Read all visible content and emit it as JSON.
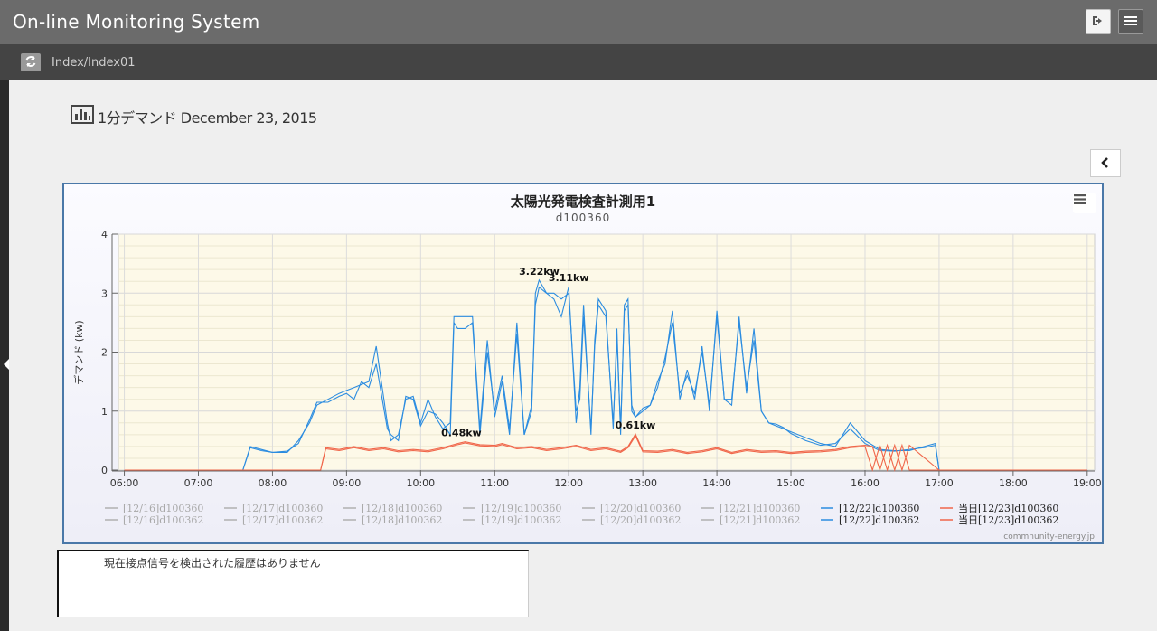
{
  "header": {
    "app_title": "On-line Monitoring System"
  },
  "icons": {
    "logout": "sign-out-icon",
    "menu": "hamburger-icon",
    "refresh": "refresh-icon",
    "chart": "bar-chart-icon",
    "collapse": "chevron-left-icon"
  },
  "breadcrumb": {
    "text": "Index/Index01"
  },
  "page": {
    "heading": "1分デマンド December 23, 2015"
  },
  "messages": {
    "no_history": "現在接点信号を検出された履歴はありません"
  },
  "chart_data": {
    "type": "line",
    "title": "太陽光発電検査計測用1",
    "subtitle": "d100360",
    "ylabel": "デマンド (kw)",
    "xlabel": "",
    "ylim": [
      0,
      4
    ],
    "x_ticks": [
      "06:00",
      "07:00",
      "08:00",
      "09:00",
      "10:00",
      "11:00",
      "12:00",
      "13:00",
      "14:00",
      "15:00",
      "16:00",
      "17:00",
      "18:00",
      "19:00"
    ],
    "y_ticks": [
      "0",
      "1",
      "2",
      "3",
      "4"
    ],
    "xlim_hours": [
      5.92,
      19.1
    ],
    "grid": true,
    "credit": "commnunity-energy.jp",
    "colors": {
      "blue": "#2b8ce0",
      "red": "#f0664a",
      "gray": "#b0b0b0",
      "plot_bg": "#fdf9e8"
    },
    "annotations": [
      {
        "text": "3.22kw",
        "x": 11.6,
        "y": 3.22
      },
      {
        "text": "3.11kw",
        "x": 12.0,
        "y": 3.11
      },
      {
        "text": "0.48kw",
        "x": 10.55,
        "y": 0.48
      },
      {
        "text": "0.61kw",
        "x": 12.9,
        "y": 0.61
      }
    ],
    "legend": [
      [
        {
          "name": "[12/16]d100360",
          "color": "#b0b0b0",
          "visible": false
        },
        {
          "name": "[12/17]d100360",
          "color": "#b0b0b0",
          "visible": false
        },
        {
          "name": "[12/18]d100360",
          "color": "#b0b0b0",
          "visible": false
        },
        {
          "name": "[12/19]d100360",
          "color": "#b0b0b0",
          "visible": false
        },
        {
          "name": "[12/20]d100360",
          "color": "#b0b0b0",
          "visible": false
        },
        {
          "name": "[12/21]d100360",
          "color": "#b0b0b0",
          "visible": false
        },
        {
          "name": "[12/22]d100360",
          "color": "#2b8ce0",
          "visible": true
        },
        {
          "name": "当日[12/23]d100360",
          "color": "#f0664a",
          "visible": true
        }
      ],
      [
        {
          "name": "[12/16]d100362",
          "color": "#b0b0b0",
          "visible": false
        },
        {
          "name": "[12/17]d100362",
          "color": "#b0b0b0",
          "visible": false
        },
        {
          "name": "[12/18]d100362",
          "color": "#b0b0b0",
          "visible": false
        },
        {
          "name": "[12/19]d100362",
          "color": "#b0b0b0",
          "visible": false
        },
        {
          "name": "[12/20]d100362",
          "color": "#b0b0b0",
          "visible": false
        },
        {
          "name": "[12/21]d100362",
          "color": "#b0b0b0",
          "visible": false
        },
        {
          "name": "[12/22]d100362",
          "color": "#2b8ce0",
          "visible": true
        },
        {
          "name": "当日[12/23]d100362",
          "color": "#f0664a",
          "visible": true
        }
      ]
    ],
    "series": [
      {
        "name": "[12/22]d100360",
        "color": "#2b8ce0",
        "x": [
          6.0,
          7.6,
          7.7,
          7.85,
          8.0,
          8.2,
          8.35,
          8.5,
          8.6,
          8.75,
          8.9,
          9.0,
          9.1,
          9.2,
          9.3,
          9.4,
          9.55,
          9.6,
          9.7,
          9.8,
          9.9,
          10.0,
          10.1,
          10.2,
          10.3,
          10.4,
          10.45,
          10.5,
          10.6,
          10.7,
          10.8,
          10.9,
          11.0,
          11.1,
          11.2,
          11.3,
          11.4,
          11.5,
          11.55,
          11.6,
          11.7,
          11.8,
          11.9,
          12.0,
          12.1,
          12.15,
          12.2,
          12.3,
          12.35,
          12.4,
          12.5,
          12.6,
          12.65,
          12.7,
          12.75,
          12.8,
          12.85,
          12.9,
          13.0,
          13.1,
          13.2,
          13.3,
          13.4,
          13.5,
          13.6,
          13.7,
          13.8,
          13.9,
          14.0,
          14.1,
          14.2,
          14.3,
          14.4,
          14.5,
          14.6,
          14.7,
          14.8,
          14.9,
          15.0,
          15.2,
          15.4,
          15.6,
          15.8,
          16.0,
          16.2,
          16.4,
          16.6,
          16.8,
          16.95,
          17.0,
          18.0,
          19.0
        ],
        "y": [
          0,
          0,
          0.4,
          0.35,
          0.3,
          0.3,
          0.5,
          0.8,
          1.1,
          1.2,
          1.3,
          1.35,
          1.4,
          1.45,
          1.5,
          2.1,
          0.8,
          0.5,
          0.6,
          1.2,
          1.25,
          0.8,
          1.2,
          0.9,
          0.7,
          0.8,
          2.6,
          2.6,
          2.6,
          2.6,
          0.7,
          2.2,
          0.9,
          1.5,
          0.6,
          2.5,
          0.6,
          1.0,
          3.0,
          3.22,
          3.0,
          2.9,
          2.6,
          3.11,
          0.8,
          1.4,
          2.8,
          0.6,
          2.2,
          2.9,
          2.7,
          0.7,
          2.4,
          0.6,
          2.8,
          2.9,
          1.0,
          0.9,
          1.0,
          1.1,
          1.5,
          1.8,
          2.7,
          1.2,
          1.7,
          1.2,
          2.1,
          1.0,
          2.7,
          1.2,
          1.1,
          2.6,
          1.3,
          2.4,
          1.0,
          0.8,
          0.75,
          0.7,
          0.65,
          0.55,
          0.45,
          0.4,
          0.8,
          0.5,
          0.35,
          0.33,
          0.33,
          0.4,
          0.45,
          0,
          0,
          0
        ]
      },
      {
        "name": "[12/22]d100362",
        "color": "#2b8ce0",
        "x": [
          6.0,
          7.6,
          7.7,
          7.85,
          8.0,
          8.2,
          8.35,
          8.5,
          8.6,
          8.75,
          8.9,
          9.0,
          9.1,
          9.2,
          9.3,
          9.4,
          9.55,
          9.6,
          9.7,
          9.8,
          9.9,
          10.0,
          10.1,
          10.2,
          10.3,
          10.4,
          10.45,
          10.5,
          10.6,
          10.7,
          10.8,
          10.9,
          11.0,
          11.1,
          11.2,
          11.3,
          11.4,
          11.5,
          11.55,
          11.6,
          11.7,
          11.8,
          11.9,
          12.0,
          12.1,
          12.15,
          12.2,
          12.3,
          12.35,
          12.4,
          12.5,
          12.6,
          12.65,
          12.7,
          12.75,
          12.8,
          12.85,
          12.9,
          13.0,
          13.1,
          13.2,
          13.3,
          13.4,
          13.5,
          13.6,
          13.7,
          13.8,
          13.9,
          14.0,
          14.1,
          14.2,
          14.3,
          14.4,
          14.5,
          14.6,
          14.7,
          14.8,
          14.9,
          15.0,
          15.2,
          15.4,
          15.6,
          15.8,
          16.0,
          16.2,
          16.4,
          16.6,
          16.8,
          16.95,
          17.0,
          18.0,
          19.0
        ],
        "y": [
          0,
          0,
          0.38,
          0.33,
          0.3,
          0.32,
          0.45,
          0.85,
          1.15,
          1.15,
          1.25,
          1.3,
          1.2,
          1.5,
          1.4,
          1.8,
          0.7,
          0.6,
          0.5,
          1.25,
          1.2,
          0.75,
          1.0,
          0.95,
          0.8,
          0.6,
          2.5,
          2.4,
          2.4,
          2.5,
          0.6,
          2.0,
          1.0,
          1.6,
          0.7,
          2.3,
          0.6,
          1.1,
          2.8,
          3.1,
          3.0,
          3.0,
          2.9,
          3.0,
          1.0,
          1.2,
          2.6,
          0.7,
          2.1,
          2.8,
          2.6,
          0.8,
          2.2,
          0.7,
          2.7,
          2.8,
          1.1,
          0.9,
          1.05,
          1.1,
          1.4,
          1.9,
          2.5,
          1.3,
          1.6,
          1.3,
          2.0,
          1.1,
          2.6,
          1.2,
          1.2,
          2.5,
          1.4,
          2.2,
          1.0,
          0.8,
          0.78,
          0.72,
          0.62,
          0.5,
          0.42,
          0.45,
          0.7,
          0.45,
          0.33,
          0.32,
          0.35,
          0.38,
          0.42,
          0,
          0,
          0
        ]
      },
      {
        "name": "当日[12/23]d100360",
        "color": "#f0664a",
        "x": [
          6.0,
          8.65,
          8.72,
          8.9,
          9.1,
          9.3,
          9.5,
          9.7,
          9.9,
          10.1,
          10.3,
          10.5,
          10.6,
          10.8,
          11.0,
          11.1,
          11.3,
          11.5,
          11.7,
          11.9,
          12.1,
          12.3,
          12.5,
          12.7,
          12.8,
          12.9,
          13.0,
          13.2,
          13.4,
          13.6,
          13.8,
          14.0,
          14.2,
          14.4,
          14.6,
          14.8,
          15.0,
          15.2,
          15.4,
          15.6,
          15.8,
          16.0,
          16.1,
          16.2,
          16.3,
          16.4,
          16.5,
          16.6,
          17.0,
          18.0,
          19.0
        ],
        "y": [
          0,
          0,
          0.38,
          0.35,
          0.4,
          0.35,
          0.38,
          0.33,
          0.35,
          0.33,
          0.38,
          0.45,
          0.48,
          0.43,
          0.42,
          0.45,
          0.38,
          0.4,
          0.35,
          0.38,
          0.42,
          0.35,
          0.38,
          0.32,
          0.4,
          0.61,
          0.33,
          0.32,
          0.35,
          0.3,
          0.33,
          0.38,
          0.3,
          0.35,
          0.32,
          0.33,
          0.3,
          0.32,
          0.33,
          0.35,
          0.4,
          0.42,
          0.4,
          0.0,
          0.42,
          0.0,
          0.42,
          0.0,
          0,
          0,
          0
        ]
      },
      {
        "name": "当日[12/23]d100362",
        "color": "#f0664a",
        "x": [
          6.0,
          8.65,
          8.72,
          8.9,
          9.1,
          9.3,
          9.5,
          9.7,
          9.9,
          10.1,
          10.3,
          10.5,
          10.6,
          10.8,
          11.0,
          11.1,
          11.3,
          11.5,
          11.7,
          11.9,
          12.1,
          12.3,
          12.5,
          12.7,
          12.8,
          12.9,
          13.0,
          13.2,
          13.4,
          13.6,
          13.8,
          14.0,
          14.2,
          14.4,
          14.6,
          14.8,
          15.0,
          15.2,
          15.4,
          15.6,
          15.8,
          16.0,
          16.1,
          16.2,
          16.3,
          16.4,
          16.5,
          16.6,
          17.0,
          18.0,
          19.0
        ],
        "y": [
          0,
          0,
          0.36,
          0.33,
          0.38,
          0.33,
          0.36,
          0.31,
          0.33,
          0.31,
          0.36,
          0.43,
          0.46,
          0.41,
          0.4,
          0.43,
          0.36,
          0.38,
          0.33,
          0.36,
          0.4,
          0.33,
          0.36,
          0.3,
          0.38,
          0.58,
          0.31,
          0.3,
          0.33,
          0.28,
          0.31,
          0.36,
          0.28,
          0.33,
          0.3,
          0.31,
          0.28,
          0.3,
          0.31,
          0.33,
          0.38,
          0.4,
          0.0,
          0.42,
          0.0,
          0.42,
          0.0,
          0.42,
          0,
          0,
          0
        ]
      }
    ]
  }
}
